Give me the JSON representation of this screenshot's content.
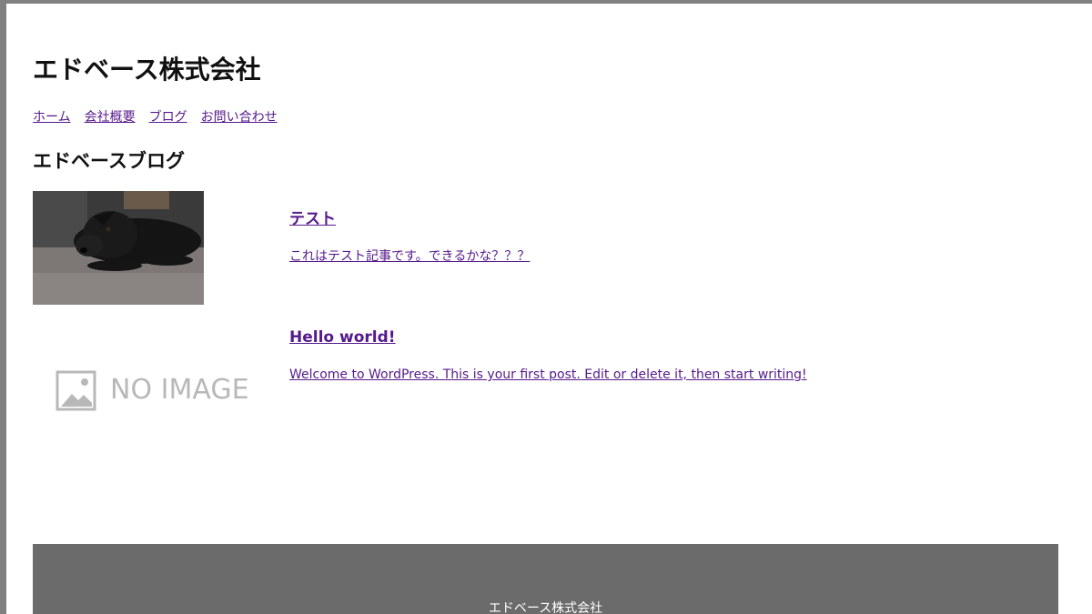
{
  "header": {
    "site_title": "エドベース株式会社"
  },
  "nav": {
    "items": [
      {
        "label": "ホーム"
      },
      {
        "label": "会社概要"
      },
      {
        "label": "ブログ"
      },
      {
        "label": "お問い合わせ"
      }
    ]
  },
  "blog": {
    "section_title": "エドベースブログ",
    "posts": [
      {
        "title": "テスト",
        "excerpt": "これはテスト記事です。できるかな？？？",
        "thumbnail": "dog-photo"
      },
      {
        "title": "Hello world!",
        "excerpt": "Welcome to WordPress. This is your first post. Edit or delete it, then start writing!",
        "thumbnail": "no-image",
        "thumbnail_text": "NO IMAGE"
      }
    ]
  },
  "footer": {
    "text": "エドベース株式会社"
  },
  "colors": {
    "link": "#551a8b",
    "footer_bg": "#6b6b6b",
    "page_bg": "#ffffff",
    "frame": "#808080"
  }
}
